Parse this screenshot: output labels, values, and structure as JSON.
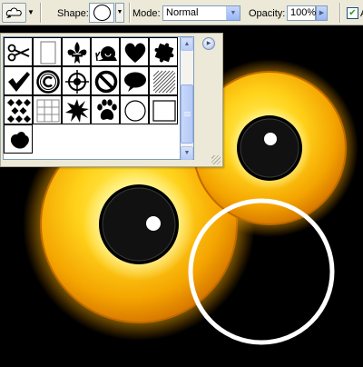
{
  "options_bar": {
    "tool_preset_icon": "custom-shape-tool-icon",
    "shape_label": "Shape:",
    "mode_label": "Mode:",
    "mode_value": "Normal",
    "opacity_label": "Opacity:",
    "opacity_value": "100%",
    "checkbox_label": "A"
  },
  "shape_picker": {
    "shapes": [
      {
        "name": "scissors"
      },
      {
        "name": "blank-page"
      },
      {
        "name": "fleur-de-lis"
      },
      {
        "name": "snail"
      },
      {
        "name": "heart"
      },
      {
        "name": "puzzle-piece"
      },
      {
        "name": "checkmark"
      },
      {
        "name": "copyright"
      },
      {
        "name": "registration-target"
      },
      {
        "name": "no-sign"
      },
      {
        "name": "speech-bubble"
      },
      {
        "name": "diagonal-lines"
      },
      {
        "name": "checkerboard-diamonds"
      },
      {
        "name": "grid"
      },
      {
        "name": "starburst"
      },
      {
        "name": "paw-print"
      },
      {
        "name": "circle-outline"
      },
      {
        "name": "square-outline"
      },
      {
        "name": "blob"
      }
    ],
    "selected": "circle-outline"
  },
  "colors": {
    "toolbar_bg": "#ece9d8",
    "canvas_bg": "#000000",
    "eye_outer": "#ffb400",
    "eye_glow": "#ffe600",
    "ring": "#ffffff"
  }
}
